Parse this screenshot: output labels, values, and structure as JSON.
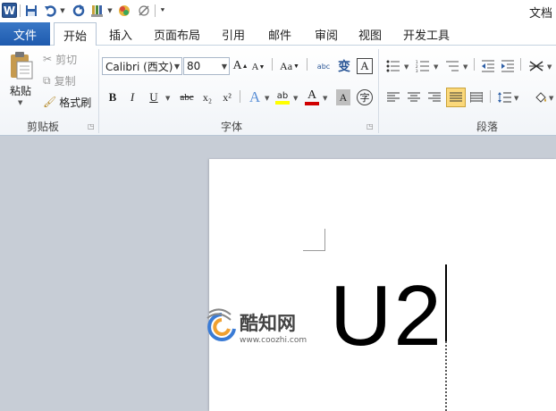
{
  "titlebar": {
    "app_logo": "W",
    "title": "文档"
  },
  "quick_access": {
    "icons": [
      "save-icon",
      "undo-icon",
      "redo-icon",
      "format-painter-icon",
      "color-icon",
      "clear-format-icon",
      "customize-toolbar-icon"
    ]
  },
  "tabs": {
    "file": "文件",
    "items": [
      "开始",
      "插入",
      "页面布局",
      "引用",
      "邮件",
      "审阅",
      "视图",
      "开发工具"
    ],
    "active": "开始"
  },
  "clipboard": {
    "paste": "粘贴",
    "cut": "剪切",
    "copy": "复制",
    "format_painter": "格式刷",
    "group_label": "剪贴板"
  },
  "font": {
    "font_name": "Calibri (西文)",
    "font_size": "80",
    "grow": "A",
    "shrink": "A",
    "change_case": "Aa",
    "pinyin": "abc",
    "char_border": "A",
    "phonetic": "变",
    "bold": "B",
    "italic": "I",
    "underline": "U",
    "strike": "abc",
    "subscript": "x₂",
    "superscript": "x²",
    "text_effect": "A",
    "highlight": "ab",
    "font_color": "A",
    "char_shading": "A",
    "enclose": "字",
    "group_label": "字体",
    "colors": {
      "highlight": "#ffff00",
      "font_color": "#d00000"
    }
  },
  "paragraph": {
    "group_label": "段落"
  },
  "document": {
    "text": "U2"
  },
  "watermark": {
    "title": "酷知网",
    "url": "www.coozhi.com"
  },
  "colors": {
    "file_tab": "#2b5797",
    "ribbon_bg": "#f1f4f8",
    "workspace_bg": "#c7cdd6",
    "page_bg": "#ffffff",
    "justify_active": "#fbd87a"
  }
}
